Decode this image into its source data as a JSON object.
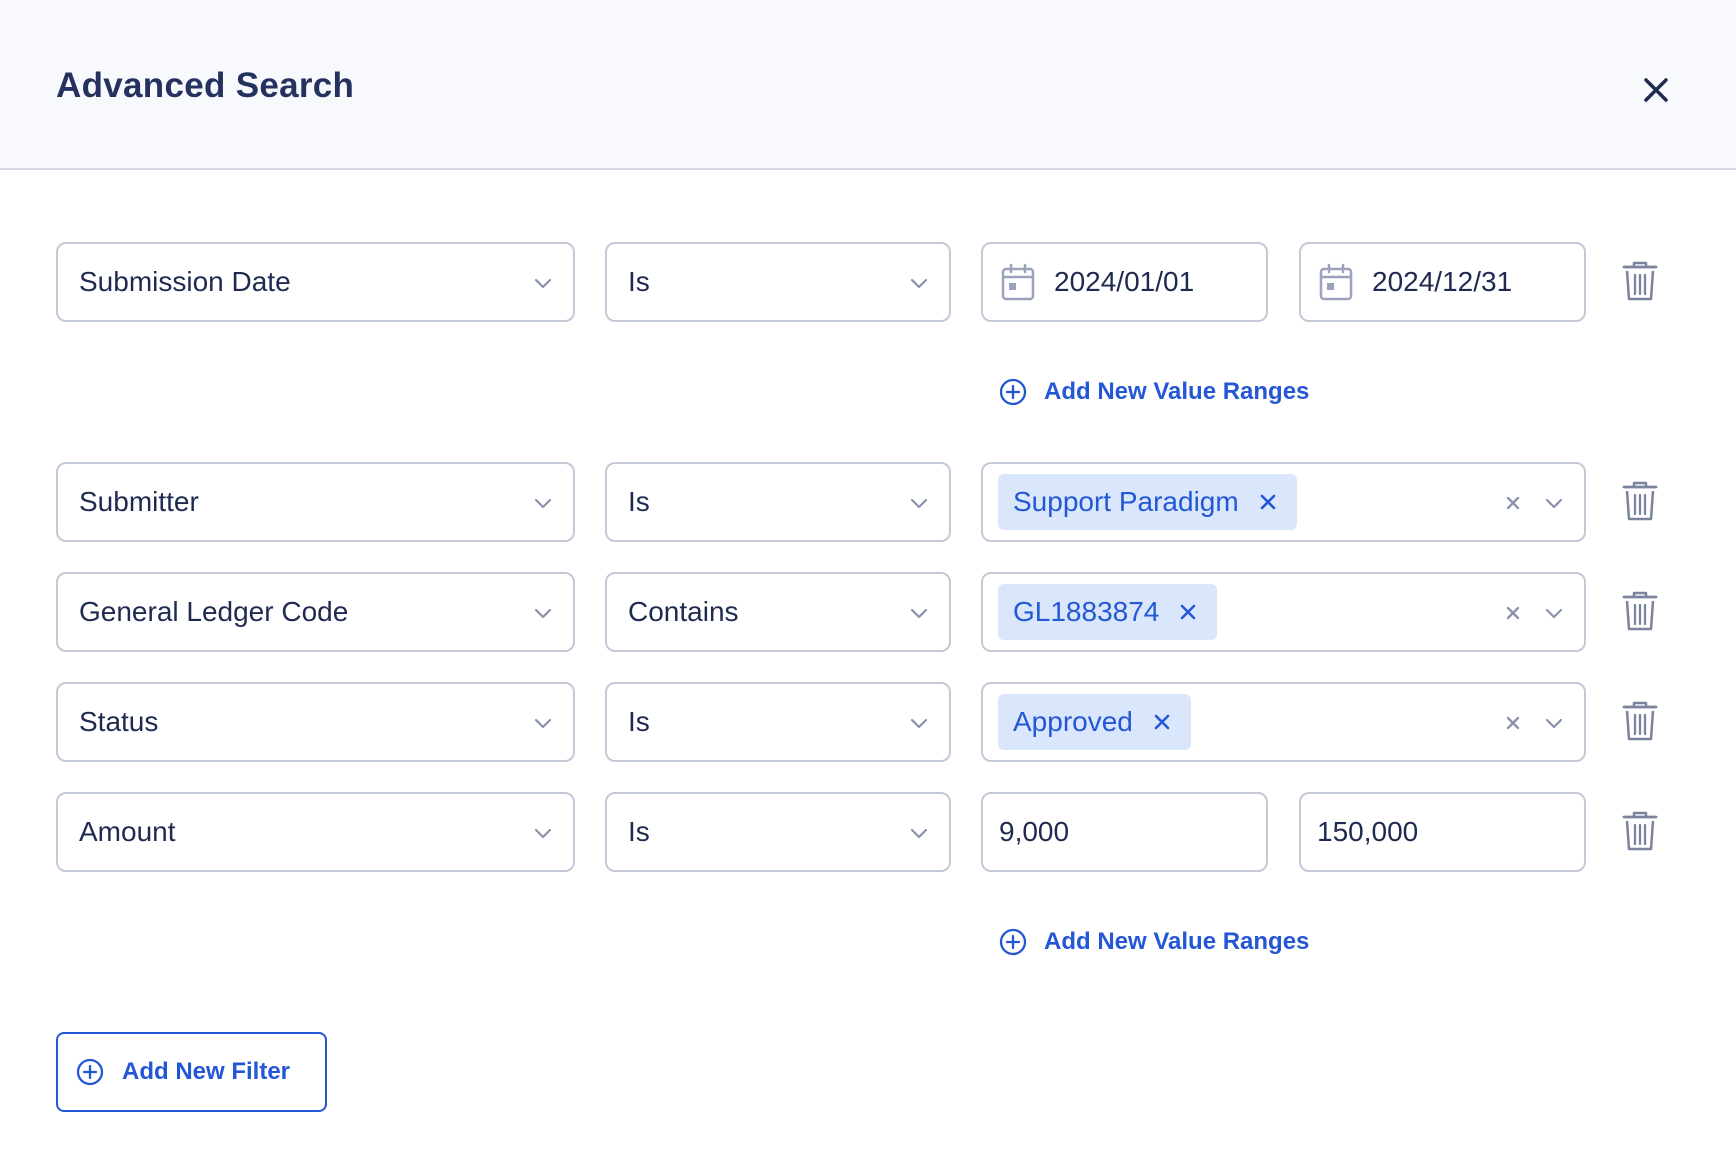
{
  "header": {
    "title": "Advanced Search",
    "close_icon": "close-icon"
  },
  "filters": [
    {
      "field": "Submission Date",
      "operator": "Is",
      "value_type": "date-range",
      "from": "2024/01/01",
      "to": "2024/12/31"
    },
    {
      "field": "Submitter",
      "operator": "Is",
      "value_type": "tags",
      "tag": "Support Paradigm"
    },
    {
      "field": "General Ledger Code",
      "operator": "Contains",
      "value_type": "tags",
      "tag": "GL1883874"
    },
    {
      "field": "Status",
      "operator": "Is",
      "value_type": "tags",
      "tag": "Approved"
    },
    {
      "field": "Amount",
      "operator": "Is",
      "value_type": "number-range",
      "from": "9,000",
      "to": "150,000"
    }
  ],
  "add_range_label": "Add New Value Ranges",
  "add_filter_label": "Add New Filter",
  "colors": {
    "accent": "#2457d6",
    "title": "#25325f",
    "border": "#c3c9d7",
    "chip_bg": "#d9e6fb",
    "header_bg": "#f8f9fc"
  }
}
